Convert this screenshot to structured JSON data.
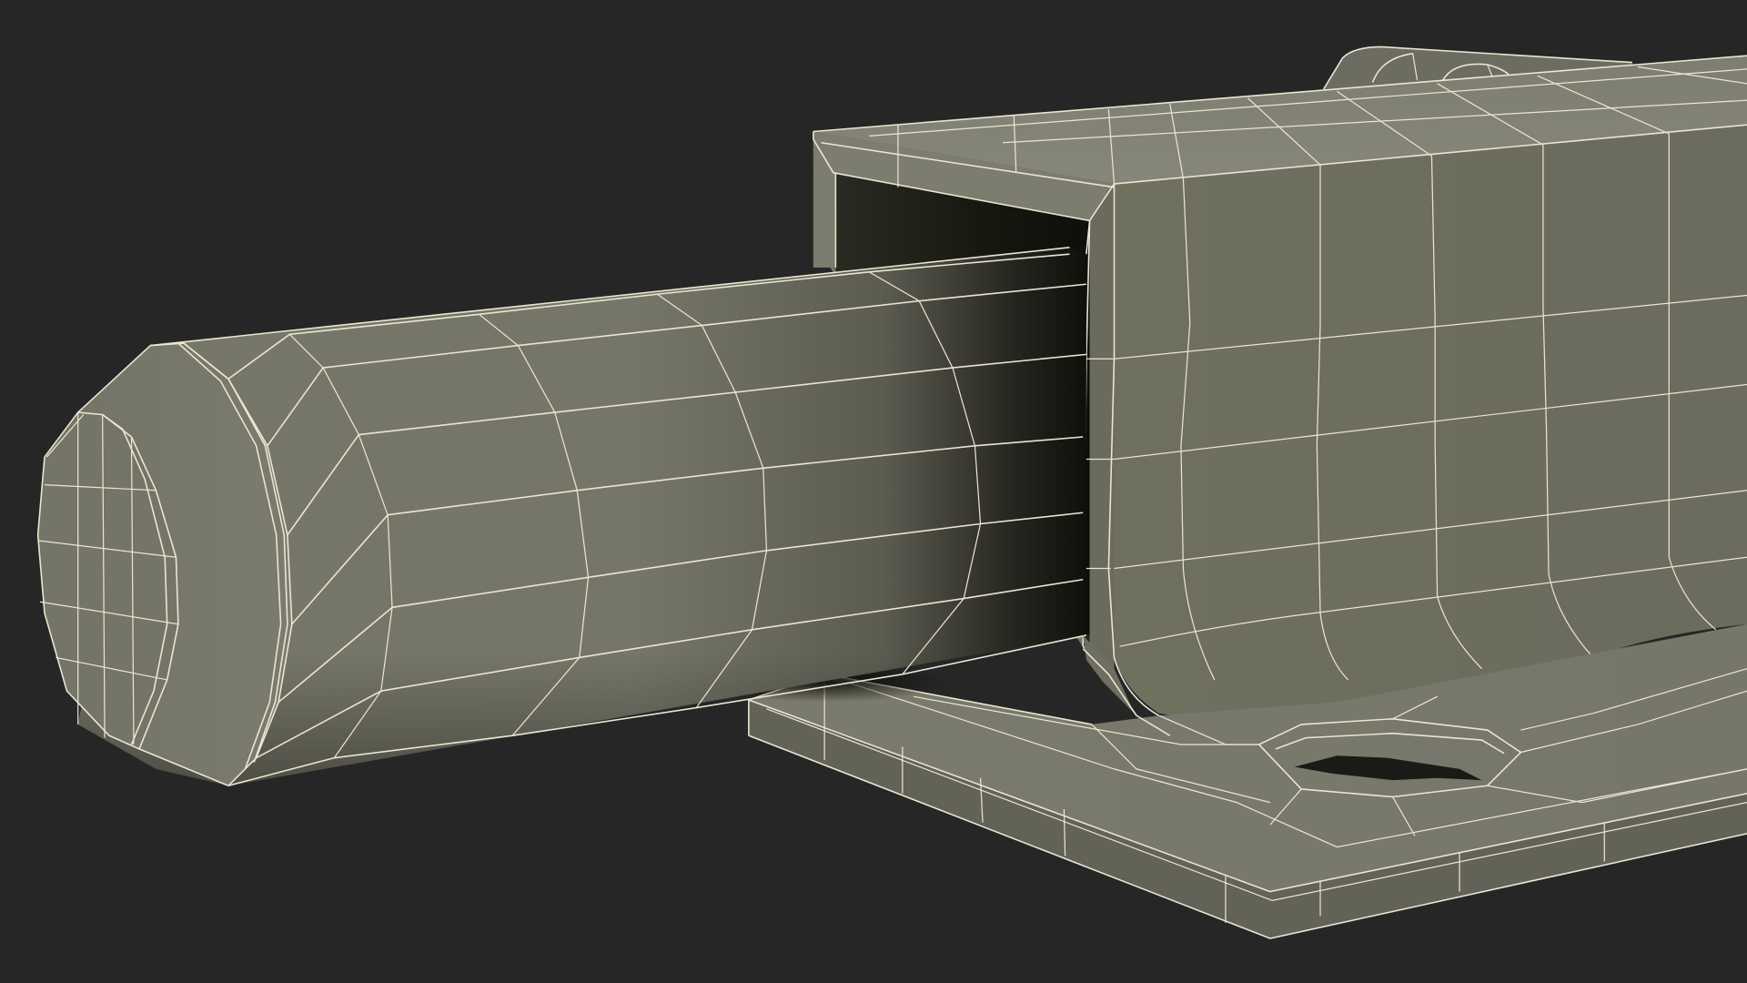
{
  "scene": {
    "subject": "bolt-latch-wireframe-render",
    "colors": {
      "background": "#262626",
      "surface": "#7a7a6c",
      "surface_light": "#86867a",
      "surface_dark": "#5f5f55",
      "interior": "#15160f",
      "wire": "#e9e6d2"
    }
  }
}
